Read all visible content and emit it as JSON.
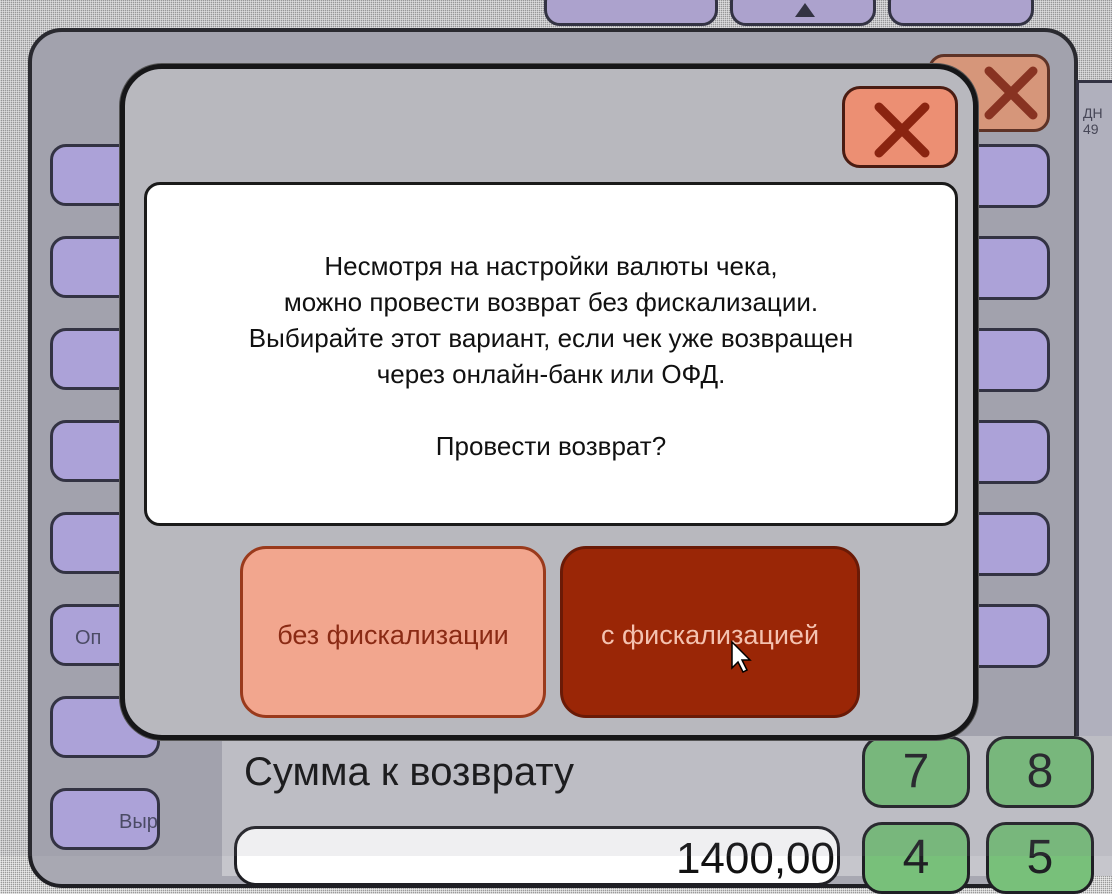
{
  "background": {
    "side_labels": [
      "Оп",
      "Выручка"
    ],
    "right_strip": [
      "ДН",
      "49"
    ],
    "sum_title": "Сумма к возврату",
    "sum_value": "1400,00",
    "keypad": [
      "7",
      "8",
      "4",
      "5"
    ]
  },
  "dialog": {
    "message_lines": [
      "Несмотря на настройки валюты чека,",
      "можно провести возврат без фискализации.",
      "Выбирайте этот вариант, если чек уже возвращен",
      "через онлайн-банк или ОФД."
    ],
    "question": "Провести возврат?",
    "button_no_fiscal": "без фискализации",
    "button_fiscal": "с фискализацией",
    "close_icon": "close-icon"
  },
  "colors": {
    "close_button": "#ec8f73",
    "button_no_fiscal": "#f2a68e",
    "button_fiscal": "#9a2606",
    "side_button": "#b3a8e3",
    "keypad": "#78c07a"
  }
}
